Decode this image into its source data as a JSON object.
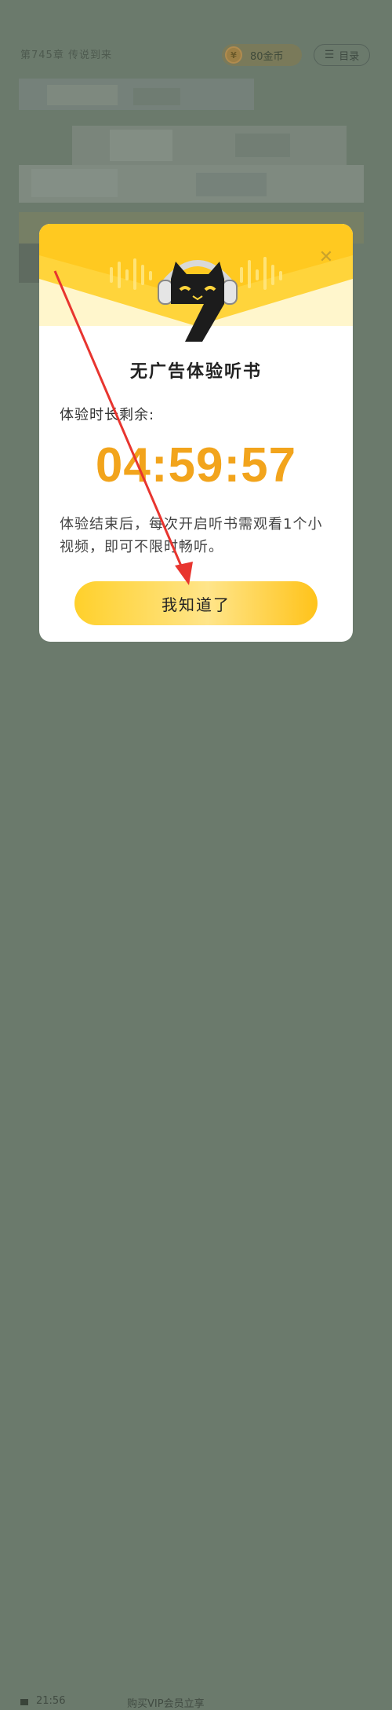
{
  "background": {
    "chapter_info": "第745章 传说到来",
    "coin_badge": "80金币",
    "toc_button": "目录",
    "clock": "21:56",
    "vip_link": "购买VIP会员立享"
  },
  "modal": {
    "title": "无广告体验听书",
    "remaining_label": "体验时长剩余:",
    "countdown": "04:59:57",
    "description": "体验结束后，每次开启听书需观看1个小视频，即可不限时畅听。",
    "confirm_button": "我知道了",
    "close_icon": "close-icon",
    "mascot_icon": "headphone-cat-7-icon"
  },
  "colors": {
    "accent": "#f2a41c",
    "button_yellow": "#ffd02b",
    "overlay": "#6b7a6c",
    "arrow": "#e8352f"
  }
}
